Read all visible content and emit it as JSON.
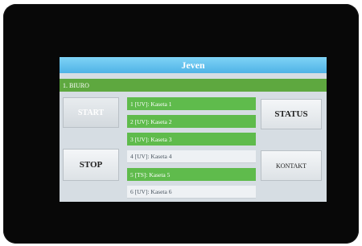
{
  "screen": {
    "title": "Jeven",
    "location": "1. BIURO"
  },
  "buttons": {
    "start": "START",
    "stop": "STOP",
    "status": "STATUS",
    "kontakt": "KONTAKT"
  },
  "cassettes": [
    {
      "label": "1 [UV]: Kaseta 1",
      "active": true
    },
    {
      "label": "2 [UV]: Kaseta 2",
      "active": true
    },
    {
      "label": "3 [UV]: Kaseta 3",
      "active": true
    },
    {
      "label": "4 [UV]: Kaseta 4",
      "active": false
    },
    {
      "label": "5 [TS]: Kaseta 5",
      "active": true
    },
    {
      "label": "6 [UV]: Kaseta 6",
      "active": false
    }
  ],
  "colors": {
    "title_bar": "#4fb3e6",
    "location_bar": "#5ea83f",
    "active_item": "#5fbb4c",
    "inactive_item": "#eef1f4"
  }
}
